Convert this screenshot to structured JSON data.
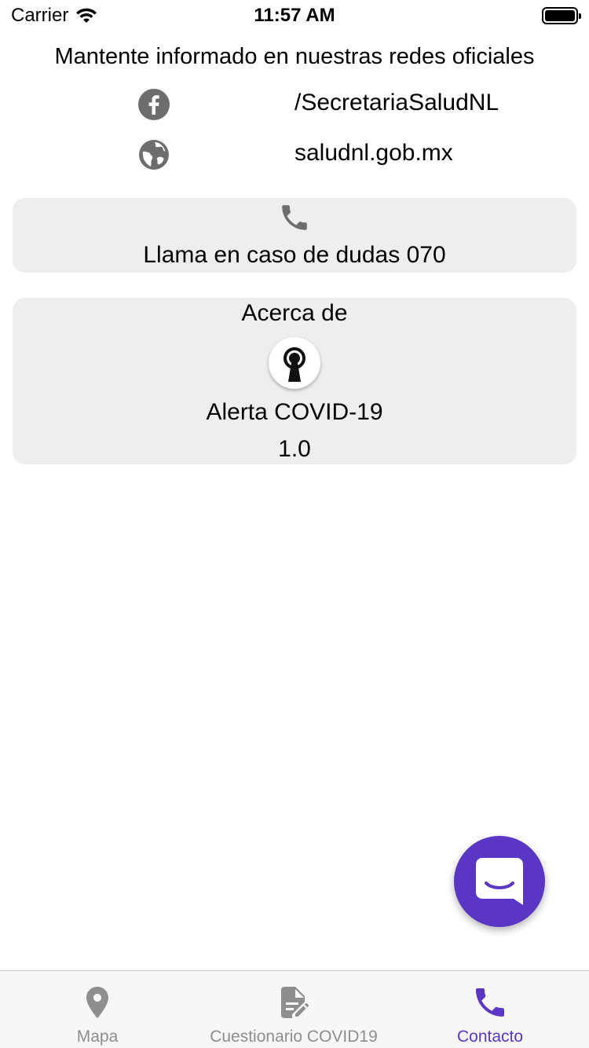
{
  "status_bar": {
    "carrier": "Carrier",
    "time": "11:57 AM"
  },
  "intro_text": "Mantente informado en nuestras redes oficiales",
  "social": {
    "facebook": {
      "icon": "facebook-icon",
      "text": "/SecretariaSaludNL"
    },
    "website": {
      "icon": "globe-icon",
      "text": "saludnl.gob.mx"
    }
  },
  "call_card": {
    "icon": "phone-icon",
    "label": "Llama en caso de dudas 070"
  },
  "about_card": {
    "title": "Acerca de",
    "logo": "app-logo",
    "app_name": "Alerta COVID-19",
    "version": "1.0"
  },
  "fab": {
    "icon": "chat-icon"
  },
  "tabs": [
    {
      "label": "Mapa",
      "icon": "map-pin-icon",
      "active": false
    },
    {
      "label": "Cuestionario COVID19",
      "icon": "document-edit-icon",
      "active": false
    },
    {
      "label": "Contacto",
      "icon": "phone-icon",
      "active": true
    }
  ],
  "colors": {
    "accent": "#5b35c4",
    "icon_gray": "#6d6d6d",
    "card_bg": "#eeeeee",
    "inactive_tab": "#8e8e8e"
  }
}
